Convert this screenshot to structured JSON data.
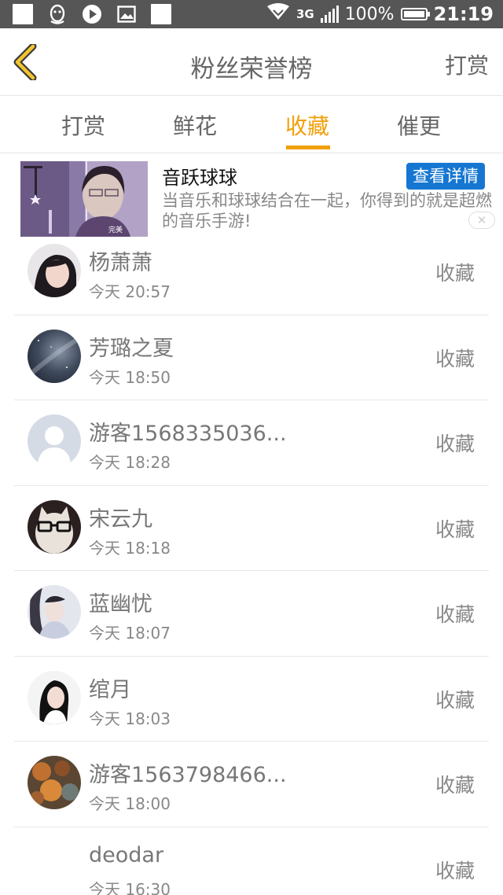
{
  "status_bar": {
    "network": "3G",
    "battery": "100%",
    "time": "21:19"
  },
  "header": {
    "title": "粉丝荣誉榜",
    "action_label": "打赏",
    "back_icon": "chevron-left-icon",
    "accent_color": "#f0a00a"
  },
  "tabs": [
    {
      "label": "打赏",
      "active": false
    },
    {
      "label": "鲜花",
      "active": false
    },
    {
      "label": "收藏",
      "active": true
    },
    {
      "label": "催更",
      "active": false
    }
  ],
  "ad": {
    "title": "音跃球球",
    "button_label": "查看详情",
    "description": "当音乐和球球结合在一起，你得到的就是超燃的音乐手游!",
    "image_caption": "完美",
    "close_icon": "close-icon"
  },
  "list": [
    {
      "name": "杨萧萧",
      "time": "今天 20:57",
      "action": "收藏"
    },
    {
      "name": "芳璐之夏",
      "time": "今天 18:50",
      "action": "收藏"
    },
    {
      "name": "游客1568335036...",
      "time": "今天 18:28",
      "action": "收藏"
    },
    {
      "name": "宋云九",
      "time": "今天 18:18",
      "action": "收藏"
    },
    {
      "name": "蓝幽忧",
      "time": "今天 18:07",
      "action": "收藏"
    },
    {
      "name": "绾月",
      "time": "今天 18:03",
      "action": "收藏"
    },
    {
      "name": "游客1563798466...",
      "time": "今天 18:00",
      "action": "收藏"
    },
    {
      "name": "deodar",
      "time": "今天 16:30",
      "action": "收藏"
    }
  ]
}
